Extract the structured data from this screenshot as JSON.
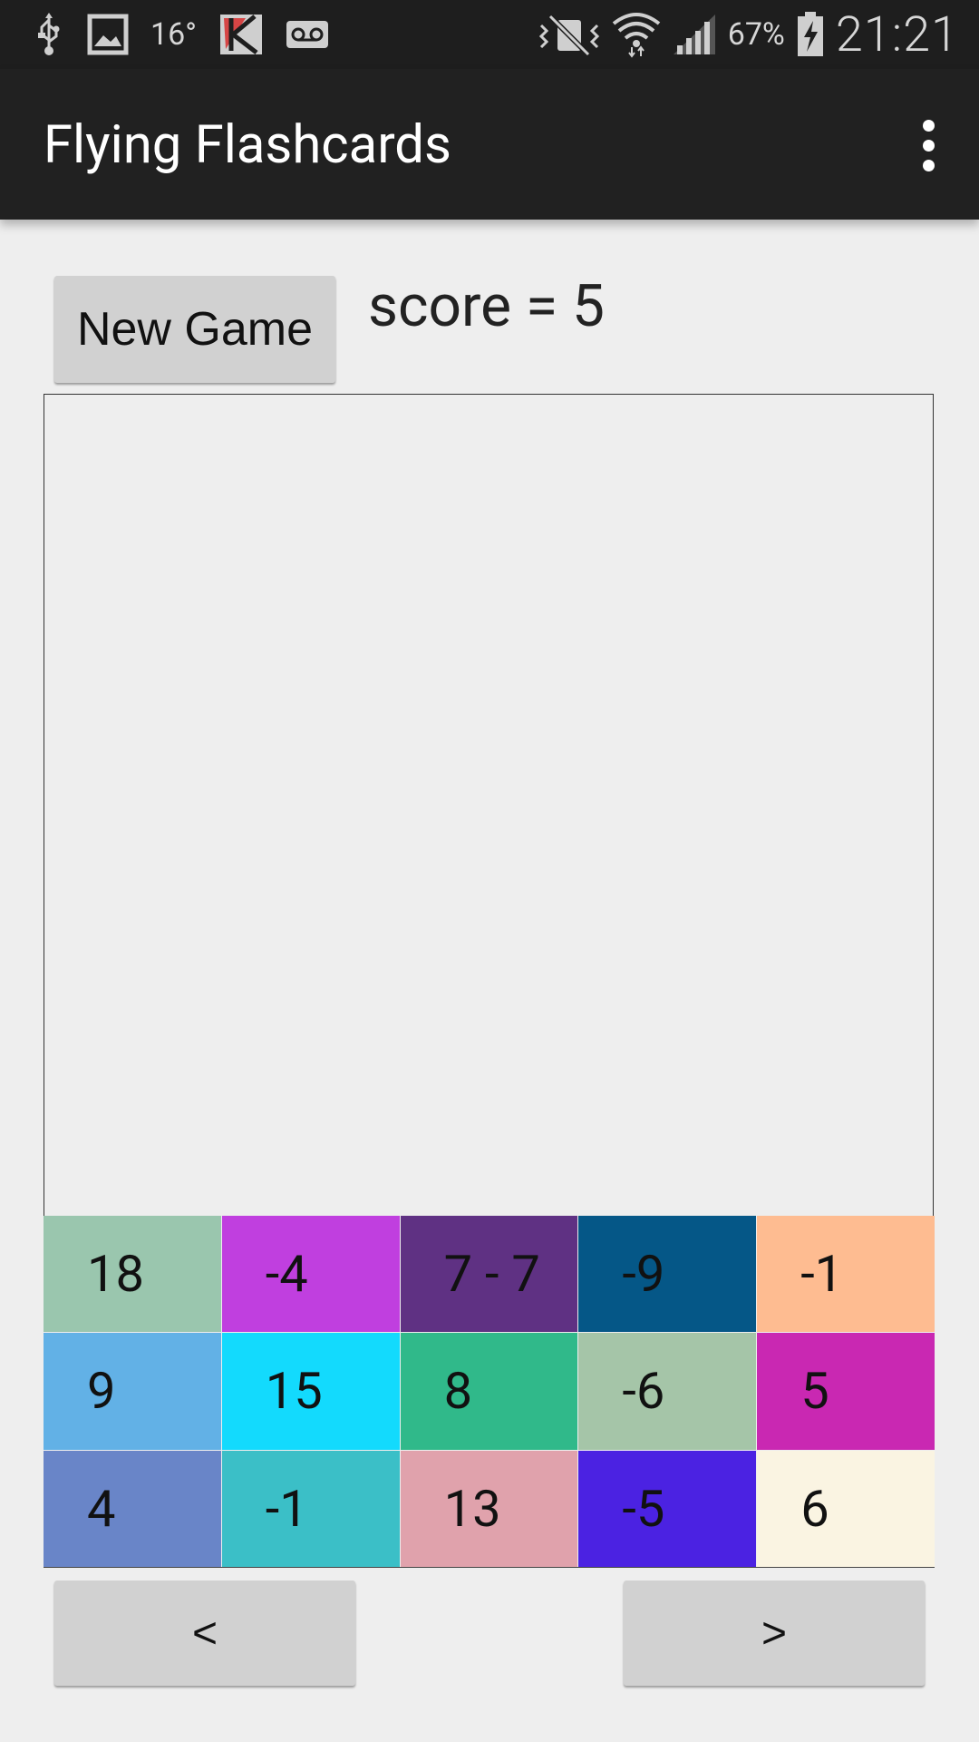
{
  "status_bar": {
    "temperature": "16°",
    "battery": "67%",
    "time": "21:21",
    "icons_left": [
      "usb-icon",
      "gallery-icon",
      "temperature",
      "kaspersky-icon",
      "voicemail-icon"
    ],
    "icons_right": [
      "mute-icon",
      "wifi-icon",
      "signal-icon",
      "battery-icon"
    ]
  },
  "action_bar": {
    "title": "Flying Flashcards",
    "menu_icon": "overflow-menu-icon"
  },
  "controls": {
    "new_game_label": "New Game",
    "score_text": "score = 5"
  },
  "cards": [
    {
      "label": "18",
      "color": "#9ac6ae"
    },
    {
      "label": "-4",
      "color": "#c03fdf"
    },
    {
      "label": "7 - 7",
      "color": "#5f3183"
    },
    {
      "label": "-9",
      "color": "#055787"
    },
    {
      "label": "-1",
      "color": "#febc91"
    },
    {
      "label": "9",
      "color": "#62b1e6"
    },
    {
      "label": "15",
      "color": "#13dafd"
    },
    {
      "label": "8",
      "color": "#30b98a"
    },
    {
      "label": "-6",
      "color": "#a5c5a8"
    },
    {
      "label": "5",
      "color": "#c928b2"
    },
    {
      "label": "4",
      "color": "#6985c8"
    },
    {
      "label": "-1",
      "color": "#3bbfc7"
    },
    {
      "label": "13",
      "color": "#e0a2ac"
    },
    {
      "label": "-5",
      "color": "#4b22e2"
    },
    {
      "label": "6",
      "color": "#faf4e2"
    }
  ],
  "navigation": {
    "prev_label": "<",
    "next_label": ">"
  }
}
